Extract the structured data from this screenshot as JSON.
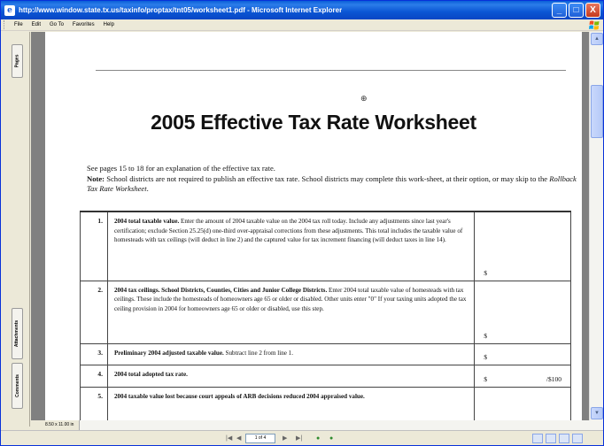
{
  "window": {
    "title": "http://www.window.state.tx.us/taxinfo/proptax/tnt05/worksheet1.pdf - Microsoft Internet Explorer",
    "buttons": {
      "minimize": "_",
      "maximize": "□",
      "close": "X"
    }
  },
  "menu": {
    "items": [
      "File",
      "Edit",
      "Go To",
      "Favorites",
      "Help"
    ]
  },
  "side_tabs": {
    "pages": "Pages",
    "attachments": "Attachments",
    "comments": "Comments"
  },
  "document": {
    "title": "2005 Effective Tax Rate Worksheet",
    "intro_line1": "See pages 15 to 18 for an explanation of the effective tax rate.",
    "note_label": "Note:",
    "note_text": " School districts are not required to publish an effective tax rate. School districts may complete this work-sheet, at their option, or may skip to the ",
    "note_italic": "Rollback Tax Rate Worksheet",
    "note_end": ".",
    "rows": [
      {
        "num": "1.",
        "bold": "2004 total taxable value.",
        "text": " Enter the amount of 2004 taxable value on the 2004 tax roll today. Include any adjustments since last year's certification; exclude Section 25.25(d) one-third over-appraisal corrections from these adjustments. This total includes the taxable value of homesteads with tax ceilings (will deduct in line 2) and the captured value for tax increment financing (will deduct taxes in line 14).",
        "dollar": "$",
        "per": ""
      },
      {
        "num": "2.",
        "bold": "2004 tax ceilings. School Districts, Counties, Cities and Junior College Districts.",
        "text": " Enter 2004 total taxable value of homesteads with tax ceilings. These include the homesteads of homeowners age 65 or older or disabled. Other units enter \"0\" If your taxing units adopted the tax ceiling provision in 2004 for homeowners age 65 or older or disabled, use this step.",
        "dollar": "$",
        "per": ""
      },
      {
        "num": "3.",
        "bold": "Preliminary 2004 adjusted taxable value.",
        "text": " Subtract line 2 from line 1.",
        "dollar": "$",
        "per": ""
      },
      {
        "num": "4.",
        "bold": "2004 total adopted tax rate.",
        "text": "",
        "dollar": "$",
        "per": "/$100"
      },
      {
        "num": "5.",
        "bold": "2004 taxable value lost because court appeals of ARB decisions reduced 2004 appraised value.",
        "text": "",
        "dollar": "",
        "per": ""
      }
    ]
  },
  "status": {
    "page_size": "8.50 x 11.00 in",
    "page_indicator": "1 of 4"
  },
  "icons": [
    "ie-page-icon",
    "windows-flag-icon",
    "zoom-in-cursor-icon",
    "first-page-icon",
    "prev-page-icon",
    "next-page-icon",
    "last-page-icon",
    "go-back-icon",
    "go-forward-icon"
  ]
}
